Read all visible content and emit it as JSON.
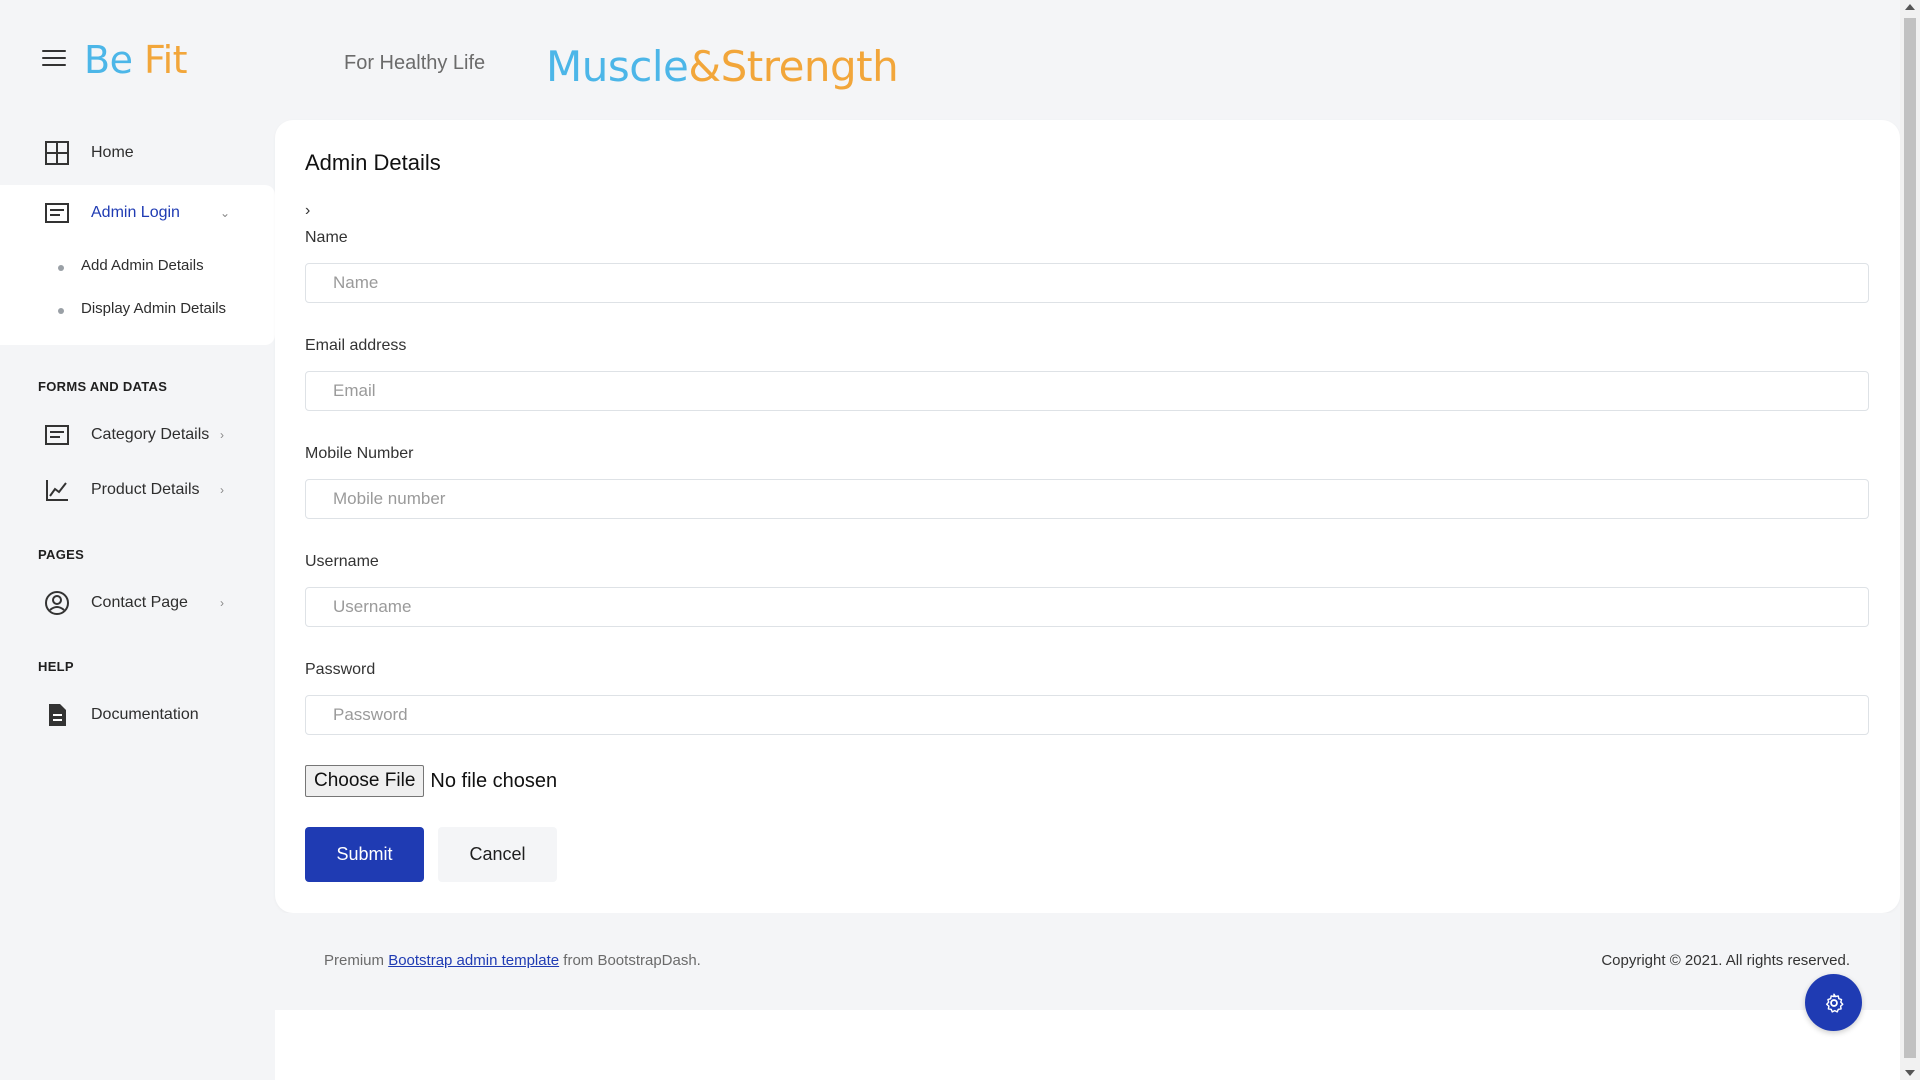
{
  "header": {
    "brand_part1": "Be ",
    "brand_part2": "Fit",
    "tagline": "For Healthy Life",
    "logo_part1": "Muscle",
    "logo_part2": "&Strength"
  },
  "sidebar": {
    "home": "Home",
    "admin_login": "Admin Login",
    "sub_items": [
      "Add Admin Details",
      "Display Admin Details"
    ],
    "section_forms": "FORMS AND DATAS",
    "category_details": "Category Details",
    "product_details": "Product Details",
    "section_pages": "PAGES",
    "contact_page": "Contact Page",
    "section_help": "HELP",
    "documentation": "Documentation"
  },
  "form": {
    "title": "Admin Details",
    "crumb": "›",
    "fields": [
      {
        "label": "Name",
        "placeholder": "Name"
      },
      {
        "label": "Email address",
        "placeholder": "Email"
      },
      {
        "label": "Mobile Number",
        "placeholder": "Mobile number"
      },
      {
        "label": "Username",
        "placeholder": "Username"
      },
      {
        "label": "Password",
        "placeholder": "Password"
      }
    ],
    "file_button": "Choose File",
    "file_status": "No file chosen",
    "submit": "Submit",
    "cancel": "Cancel"
  },
  "footer": {
    "left_prefix": "Premium ",
    "left_link": "Bootstrap admin template",
    "left_suffix": " from BootstrapDash.",
    "right": "Copyright © 2021. All rights reserved."
  },
  "colors": {
    "accent": "#1f3bb3",
    "brand_blue": "#4cb6e8",
    "brand_orange": "#f2a63a"
  }
}
